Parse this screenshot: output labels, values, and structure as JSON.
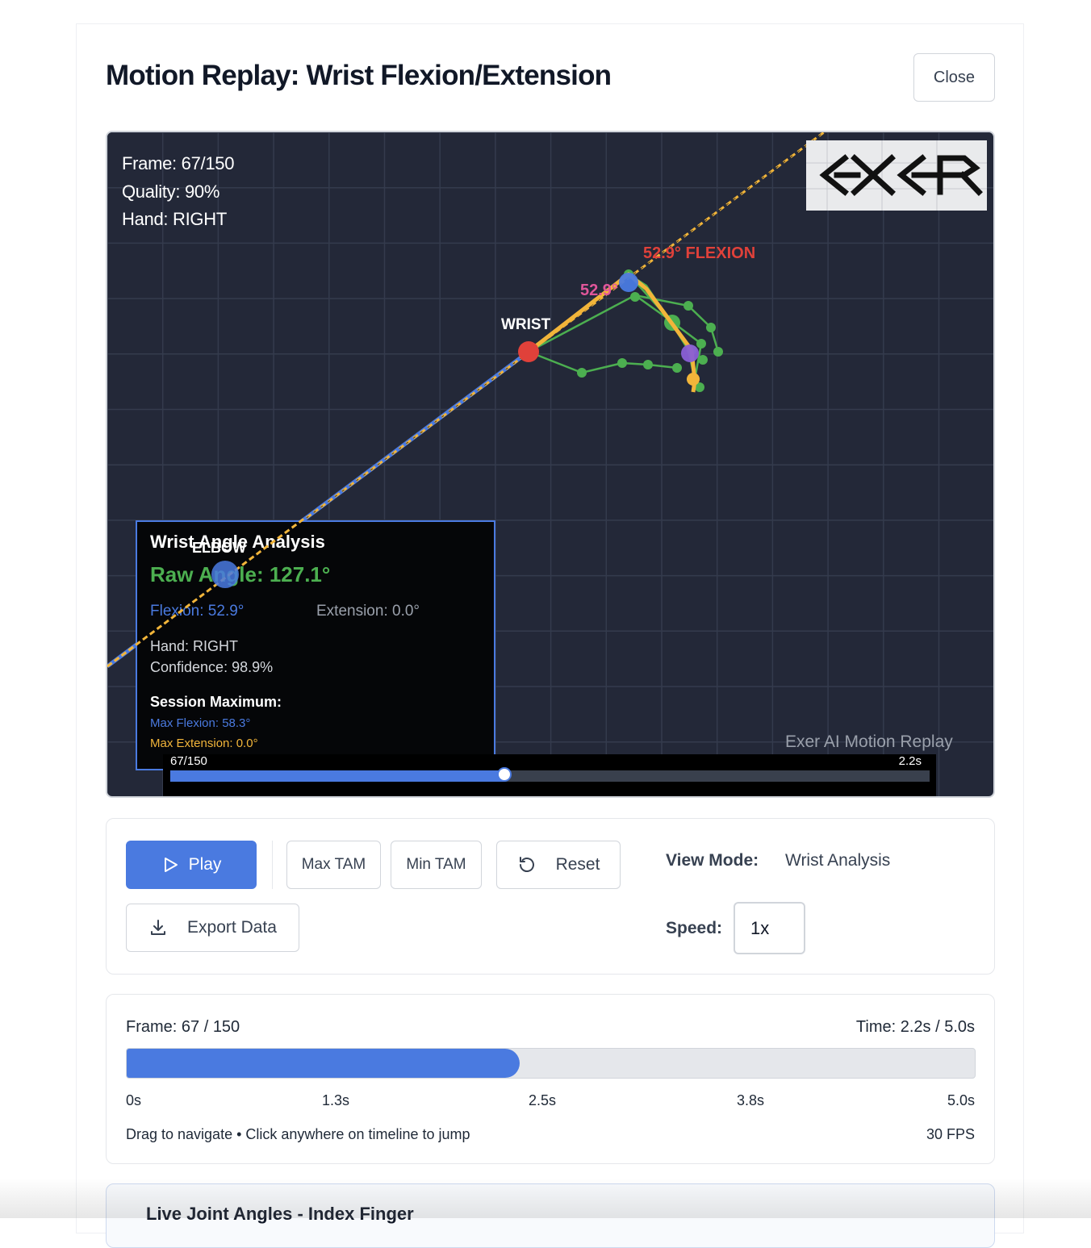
{
  "modal": {
    "title": "Motion Replay: Wrist Flexion/Extension",
    "close_label": "Close"
  },
  "canvas": {
    "hud": {
      "frame": "Frame: 67/150",
      "quality": "Quality: 90%",
      "hand": "Hand: RIGHT"
    },
    "logo_text": "EXER",
    "labels": {
      "flexion": "52.9° FLEXION",
      "angle_arc": "52.9°",
      "wrist": "WRIST",
      "elbow": "ELBOW"
    },
    "analysis": {
      "title": "Wrist Angle Analysis",
      "raw_angle": "Raw Angle: 127.1°",
      "flexion": "Flexion: 52.9°",
      "extension": "Extension: 0.0°",
      "hand": "Hand: RIGHT",
      "confidence": "Confidence: 98.9%",
      "session_title": "Session Maximum:",
      "max_flexion": "Max Flexion: 58.3°",
      "max_extension": "Max Extension: 0.0°"
    },
    "watermark": "Exer AI Motion Replay",
    "scrubber": {
      "frame_label": "67/150",
      "time_label": "2.2s",
      "progress": 0.44
    },
    "colors": {
      "background": "#232838",
      "wrist_point": "#e0413a",
      "elbow_point": "#4a7ae0",
      "forearm_line": "#f2b53a",
      "hand_skeleton": "#4caf50",
      "flexion_label": "#e0413a",
      "angle_label": "#e0569a"
    }
  },
  "controls": {
    "play_label": "Play",
    "max_tam_label": "Max TAM",
    "min_tam_label": "Min TAM",
    "reset_label": "Reset",
    "export_label": "Export Data",
    "view_mode_label": "View Mode:",
    "view_mode_value": "Wrist Analysis",
    "speed_label": "Speed:",
    "speed_value": "1x"
  },
  "timeline": {
    "frame_text": "Frame: 67 / 150",
    "time_text": "Time: 2.2s / 5.0s",
    "progress": 0.4467,
    "ticks": [
      "0s",
      "1.3s",
      "2.5s",
      "3.8s",
      "5.0s"
    ],
    "hint": "Drag to navigate • Click anywhere on timeline to jump",
    "fps": "30 FPS"
  },
  "angles_card": {
    "title": "Live Joint Angles - Index Finger"
  }
}
